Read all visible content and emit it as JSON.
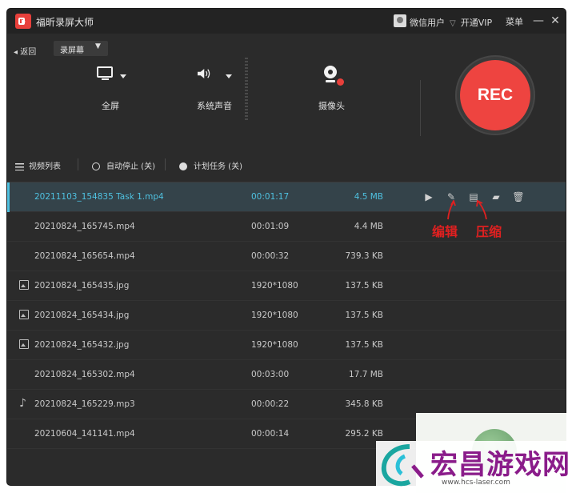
{
  "titlebar": {
    "app_title": "福昕录屏大师",
    "user": "微信用户",
    "vip": "开通VIP",
    "menu": "菜单",
    "minimize": "—",
    "close": "✕"
  },
  "controls": {
    "back": "◂ 返回",
    "mode": "录屏幕",
    "mode_chevron": "▼",
    "tools": [
      {
        "label": "全屏",
        "icon": "monitor-icon"
      },
      {
        "label": "系统声音",
        "icon": "speaker-icon"
      },
      {
        "label": "摄像头",
        "icon": "webcam-icon"
      }
    ],
    "rec": "REC"
  },
  "tabs": {
    "video_list": "视频列表",
    "auto_stop": "自动停止 (关)",
    "scheduled": "计划任务 (关)"
  },
  "files": [
    {
      "name": "20211103_154835 Task 1.mp4",
      "duration": "00:01:17",
      "size": "4.5 MB",
      "type": "video",
      "selected": true
    },
    {
      "name": "20210824_165745.mp4",
      "duration": "00:01:09",
      "size": "4.4 MB",
      "type": "video"
    },
    {
      "name": "20210824_165654.mp4",
      "duration": "00:00:32",
      "size": "739.3 KB",
      "type": "video"
    },
    {
      "name": "20210824_165435.jpg",
      "duration": "1920*1080",
      "size": "137.5 KB",
      "type": "image"
    },
    {
      "name": "20210824_165434.jpg",
      "duration": "1920*1080",
      "size": "137.5 KB",
      "type": "image"
    },
    {
      "name": "20210824_165432.jpg",
      "duration": "1920*1080",
      "size": "137.5 KB",
      "type": "image"
    },
    {
      "name": "20210824_165302.mp4",
      "duration": "00:03:00",
      "size": "17.7 MB",
      "type": "video"
    },
    {
      "name": "20210824_165229.mp3",
      "duration": "00:00:22",
      "size": "345.8 KB",
      "type": "audio"
    },
    {
      "name": "20210604_141141.mp4",
      "duration": "00:00:14",
      "size": "295.2 KB",
      "type": "video"
    }
  ],
  "row_actions": [
    "play-icon",
    "edit-icon",
    "compress-icon",
    "folder-icon",
    "trash-icon"
  ],
  "annotations": {
    "edit": "编辑",
    "compress": "压缩"
  },
  "watermark": {
    "text": "宏昌游戏网",
    "url": "www.hcs-laser.com"
  },
  "colors": {
    "accent": "#4fc1e0",
    "rec": "#ee4440",
    "annotation": "#e02020"
  }
}
